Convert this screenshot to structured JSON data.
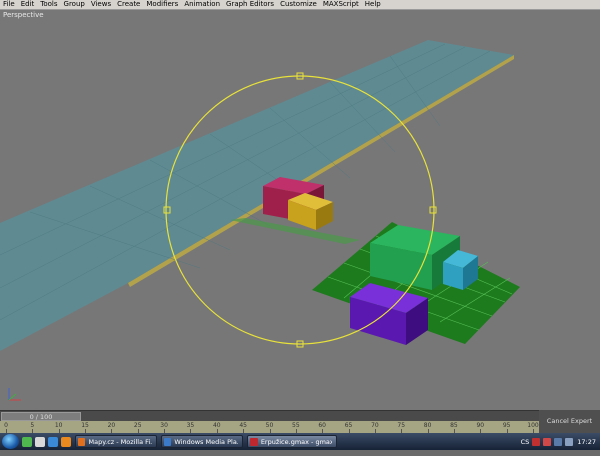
{
  "menubar": {
    "items": [
      "File",
      "Edit",
      "Tools",
      "Group",
      "Views",
      "Create",
      "Modifiers",
      "Animation",
      "Graph Editors",
      "Customize",
      "MAXScript",
      "Help"
    ]
  },
  "viewport": {
    "label": "Perspective"
  },
  "timeline": {
    "slider_label": "0 / 100",
    "ticks": [
      "0",
      "5",
      "10",
      "15",
      "20",
      "25",
      "30",
      "35",
      "40",
      "45",
      "50",
      "55",
      "60",
      "65",
      "70",
      "75",
      "80",
      "85",
      "90",
      "95",
      "100"
    ],
    "mode_label": "Cancel Expert Mode"
  },
  "taskbar": {
    "tasks": [
      "Mapy.cz - Mozilla Fi...",
      "Windows Media Pla...",
      "Erpužice.gmax - gmax"
    ],
    "tray": {
      "lang": "CS",
      "time": "17:27"
    }
  },
  "colors": {
    "road": "#5f8a92",
    "road_edge": "#b2a24c",
    "ground": "#1d7a1d",
    "gizmo": "#e8e23a",
    "box_red": "#a0204c",
    "box_yellow": "#c8a21c",
    "box_green": "#22a050",
    "box_cyan": "#2fa0c0",
    "box_purple": "#5a18b0"
  }
}
